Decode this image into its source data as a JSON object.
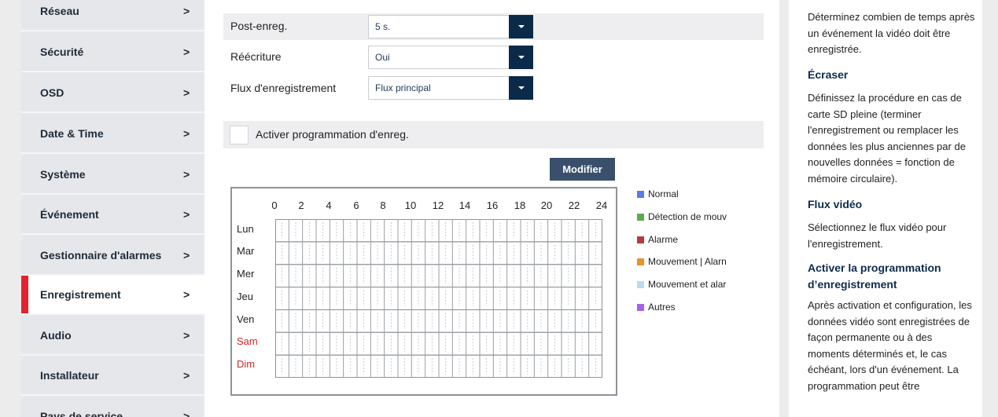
{
  "sidebar": {
    "items": [
      {
        "label": "Réseau"
      },
      {
        "label": "Sécurité"
      },
      {
        "label": "OSD"
      },
      {
        "label": "Date & Time"
      },
      {
        "label": "Système"
      },
      {
        "label": "Événement"
      },
      {
        "label": "Gestionnaire d'alarmes"
      },
      {
        "label": "Enregistrement",
        "active": true
      },
      {
        "label": "Audio"
      },
      {
        "label": "Installateur"
      },
      {
        "label": "Pays de service"
      }
    ],
    "chevron": ">"
  },
  "form": {
    "post_record": {
      "label": "Post-enreg.",
      "value": "5 s."
    },
    "overwrite": {
      "label": "Réécriture",
      "value": "Oui"
    },
    "stream": {
      "label": "Flux d'enregistrement",
      "value": "Flux principal"
    }
  },
  "schedule_toggle": {
    "label": "Activer programmation d'enreg.",
    "checked": false
  },
  "modify_button": "Modifier",
  "schedule": {
    "hours": [
      "0",
      "2",
      "4",
      "6",
      "8",
      "10",
      "12",
      "14",
      "16",
      "18",
      "20",
      "22",
      "24"
    ],
    "days": [
      "Lun",
      "Mar",
      "Mer",
      "Jeu",
      "Ven",
      "Sam",
      "Dim"
    ],
    "weekend_color": "#d4282c"
  },
  "legend": [
    {
      "label": "Normal",
      "color": "#5b7be6"
    },
    {
      "label": "Détection de mouv",
      "color": "#5cab4f"
    },
    {
      "label": "Alarme",
      "color": "#b8393f"
    },
    {
      "label": "Mouvement | Alarn",
      "color": "#e8922b"
    },
    {
      "label": "Mouvement et alar",
      "color": "#b9dcf0"
    },
    {
      "label": "Autres",
      "color": "#a463e8"
    }
  ],
  "help": {
    "intro": "Déterminez combien de temps après un événement la vidéo doit être enregistrée.",
    "overwrite_title": "Écraser",
    "overwrite_text": "Définissez la procédure en cas de carte SD pleine (terminer l'enregistrement ou remplacer les données les plus anciennes par de nouvelles données = fonction de mémoire circulaire).",
    "stream_title": "Flux vidéo",
    "stream_text": "Sélectionnez le flux vidéo pour l'enregistrement.",
    "schedule_title": "Activer la programmation d’enregistrement",
    "schedule_text": "Après activation et configuration, les données vidéo sont enregistrées de façon permanente ou à des moments déterminés et, le cas échéant, lors d'un événement. La programmation peut être"
  }
}
